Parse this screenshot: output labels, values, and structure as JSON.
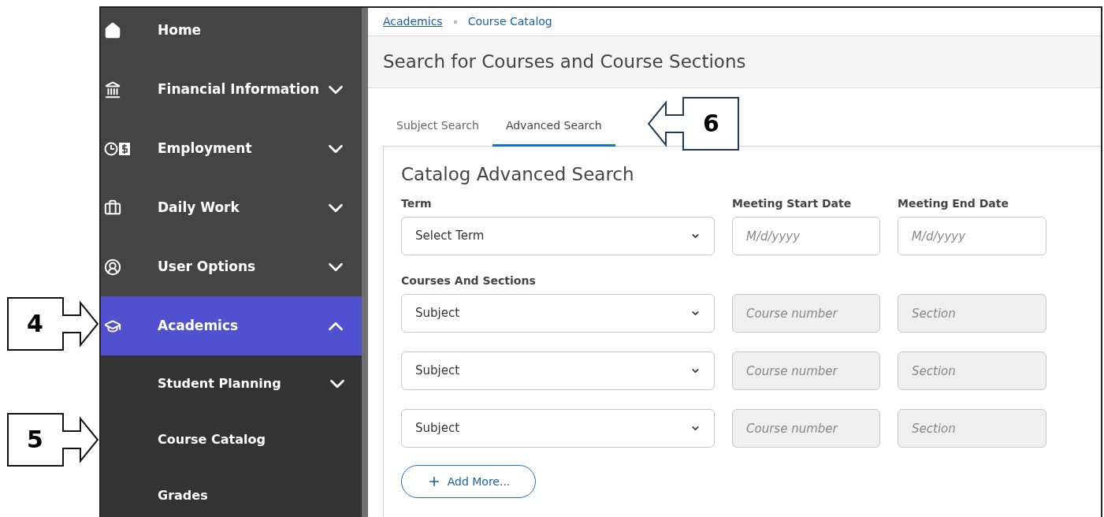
{
  "callouts": [
    {
      "label": "4"
    },
    {
      "label": "5"
    },
    {
      "label": "6"
    }
  ],
  "sidebar": {
    "items": [
      {
        "label": "Home",
        "selected": false
      },
      {
        "label": "Financial Information",
        "selected": false,
        "expanded": false
      },
      {
        "label": "Employment",
        "selected": false,
        "expanded": false
      },
      {
        "label": "Daily Work",
        "selected": false,
        "expanded": false
      },
      {
        "label": "User Options",
        "selected": false,
        "expanded": false
      },
      {
        "label": "Academics",
        "selected": true,
        "expanded": true,
        "children": [
          {
            "label": "Student Planning",
            "expanded": false
          },
          {
            "label": "Course Catalog"
          },
          {
            "label": "Grades"
          }
        ]
      }
    ]
  },
  "breadcrumb": [
    "Academics",
    "Course Catalog"
  ],
  "page_title": "Search for Courses and Course Sections",
  "tabs": [
    {
      "label": "Subject Search",
      "selected": false
    },
    {
      "label": "Advanced Search",
      "selected": true
    }
  ],
  "form": {
    "title": "Catalog Advanced Search",
    "term_row": [
      {
        "label": "Term",
        "kind": "select",
        "value": "Select Term",
        "disabled": false
      },
      {
        "label": "Meeting Start Date",
        "kind": "text",
        "placeholder": "M/d/yyyy",
        "disabled": false
      },
      {
        "label": "Meeting End Date",
        "kind": "text",
        "placeholder": "M/d/yyyy",
        "disabled": false
      }
    ],
    "courses_label": "Courses And Sections",
    "course_rows": [
      [
        {
          "kind": "select",
          "value": "Subject",
          "disabled": false
        },
        {
          "kind": "text",
          "placeholder": "Course number",
          "disabled": true
        },
        {
          "kind": "text",
          "placeholder": "Section",
          "disabled": true
        }
      ],
      [
        {
          "kind": "select",
          "value": "Subject",
          "disabled": false
        },
        {
          "kind": "text",
          "placeholder": "Course number",
          "disabled": true
        },
        {
          "kind": "text",
          "placeholder": "Section",
          "disabled": true
        }
      ],
      [
        {
          "kind": "select",
          "value": "Subject",
          "disabled": false
        },
        {
          "kind": "text",
          "placeholder": "Course number",
          "disabled": true
        },
        {
          "kind": "text",
          "placeholder": "Section",
          "disabled": true
        }
      ]
    ],
    "add_button": "Add More..."
  }
}
